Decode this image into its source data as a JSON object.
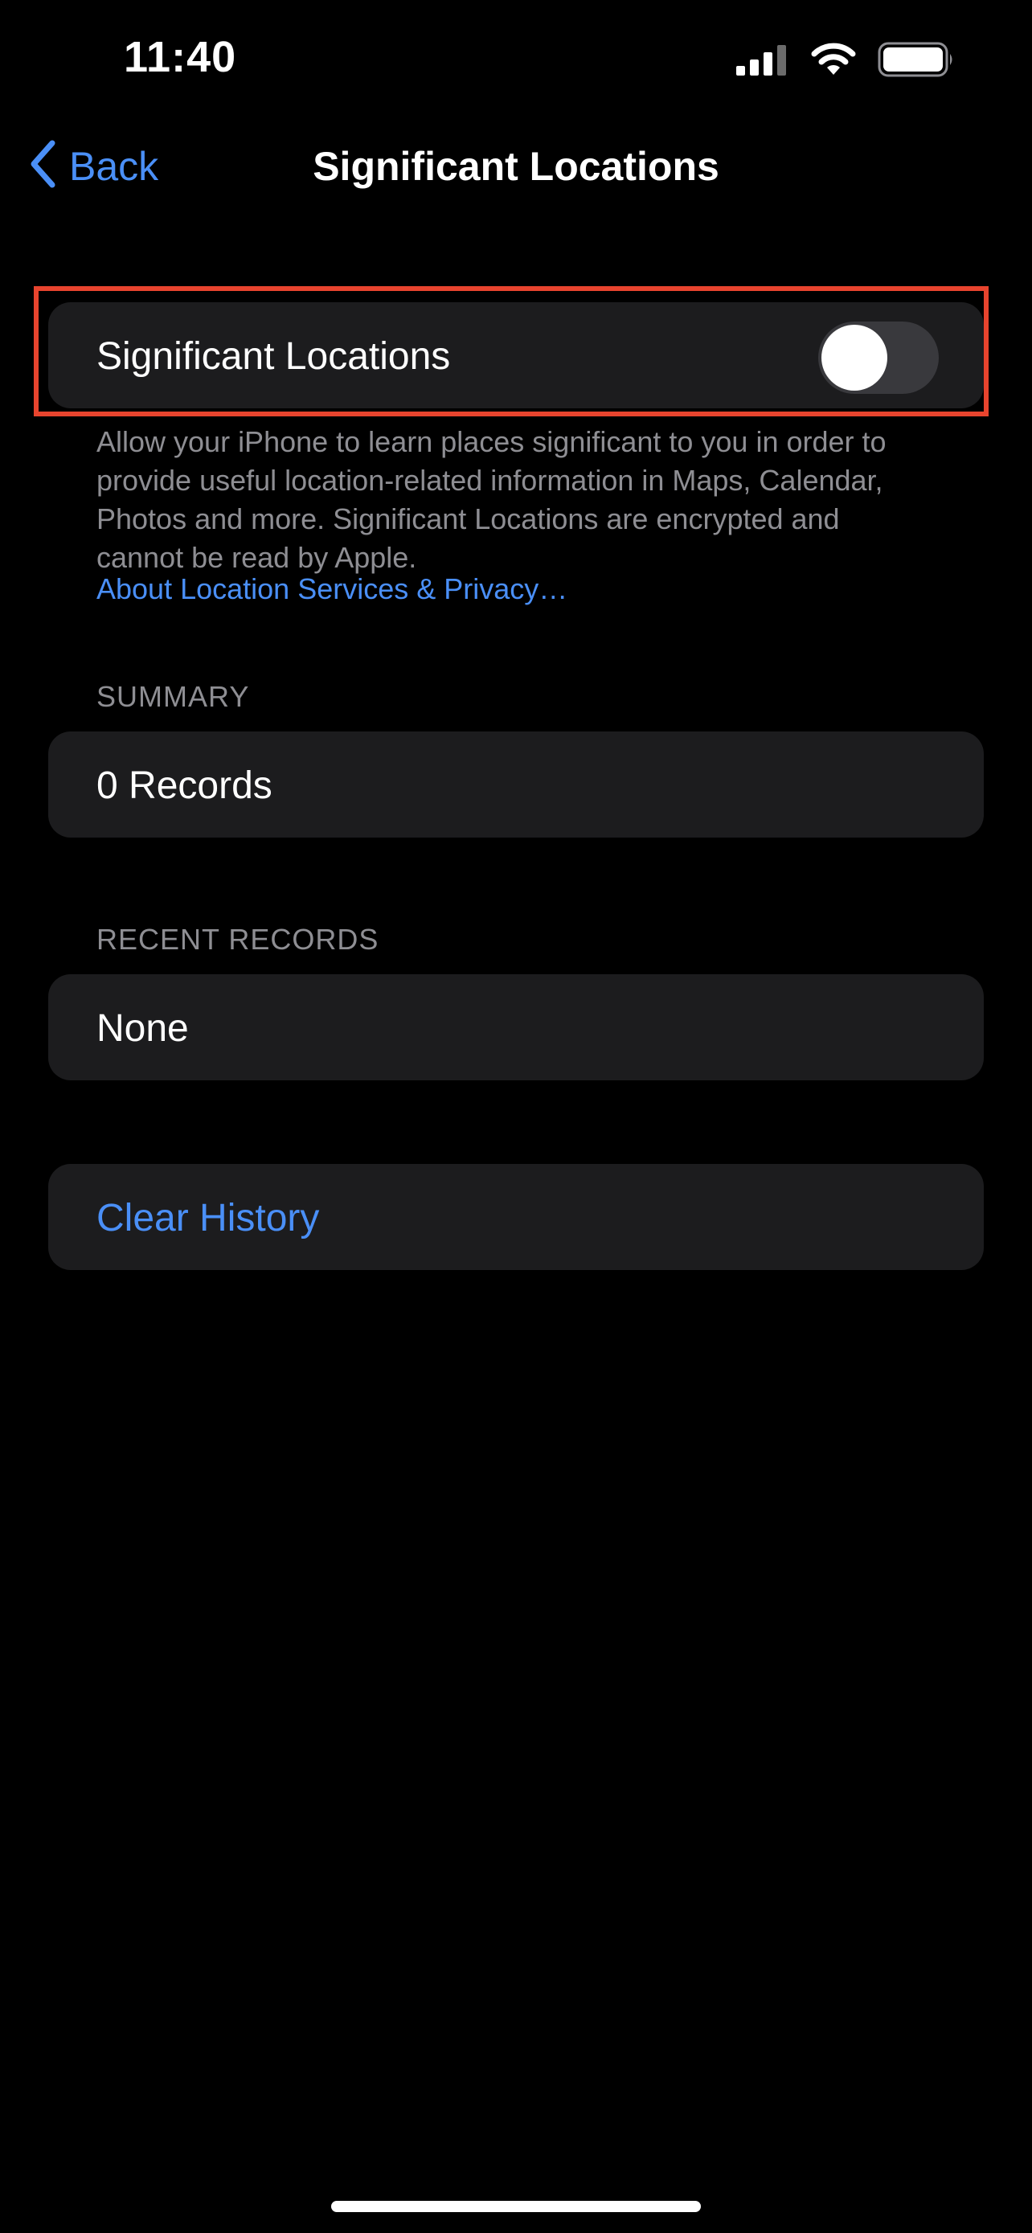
{
  "status_bar": {
    "time": "11:40"
  },
  "nav": {
    "back_label": "Back",
    "title": "Significant Locations"
  },
  "toggle_cell": {
    "label": "Significant Locations",
    "enabled": false
  },
  "footer": {
    "description": "Allow your iPhone to learn places significant to you in order to provide useful location-related information in Maps, Calendar, Photos and more. Significant Locations are encrypted and cannot be read by Apple.",
    "link": "About Location Services & Privacy…"
  },
  "summary": {
    "header": "SUMMARY",
    "value": "0 Records"
  },
  "recent_records": {
    "header": "RECENT RECORDS",
    "value": "None"
  },
  "actions": {
    "clear_history": "Clear History"
  },
  "icons": {
    "back": "chevron-left-icon",
    "signal": "cellular-signal-icon",
    "wifi": "wifi-icon",
    "battery": "battery-icon"
  },
  "colors": {
    "background": "#000000",
    "cell": "#1c1c1e",
    "accent": "#4a8ff7",
    "secondary_text": "#8e8e93",
    "highlight": "#e8442e",
    "toggle_off": "#39393d"
  }
}
